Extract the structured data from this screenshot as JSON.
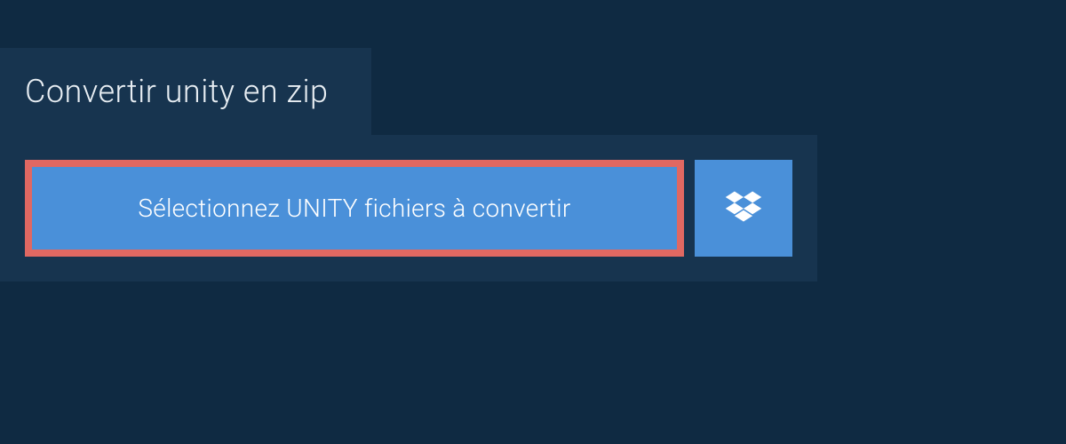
{
  "header": {
    "title": "Convertir unity en zip"
  },
  "upload": {
    "select_label": "Sélectionnez UNITY fichiers à convertir"
  }
}
